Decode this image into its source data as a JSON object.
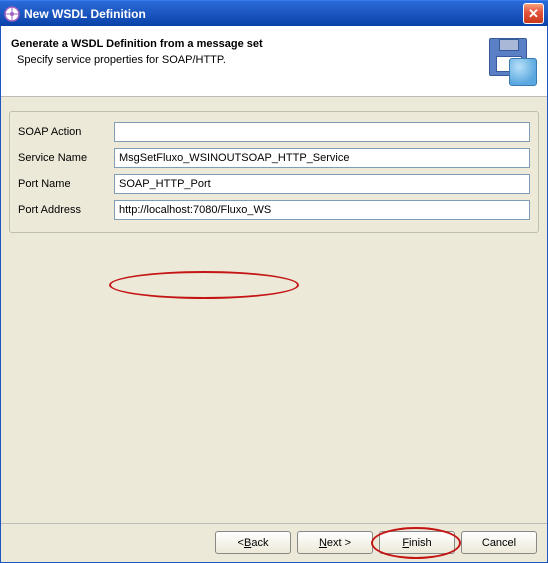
{
  "titlebar": {
    "title": "New WSDL Definition"
  },
  "header": {
    "title": "Generate a WSDL Definition from a message set",
    "subtitle": "Specify service properties for SOAP/HTTP."
  },
  "form": {
    "soap_action": {
      "label": "SOAP Action",
      "value": ""
    },
    "service_name": {
      "label": "Service Name",
      "value": "MsgSetFluxo_WSINOUTSOAP_HTTP_Service"
    },
    "port_name": {
      "label": "Port Name",
      "value": "SOAP_HTTP_Port"
    },
    "port_address": {
      "label": "Port Address",
      "value": "http://localhost:7080/Fluxo_WS"
    }
  },
  "buttons": {
    "back": "< ",
    "back_mn": "B",
    "back_rest": "ack",
    "next_mn": "N",
    "next_rest": "ext >",
    "finish_mn": "F",
    "finish_rest": "inish",
    "cancel": "Cancel"
  }
}
